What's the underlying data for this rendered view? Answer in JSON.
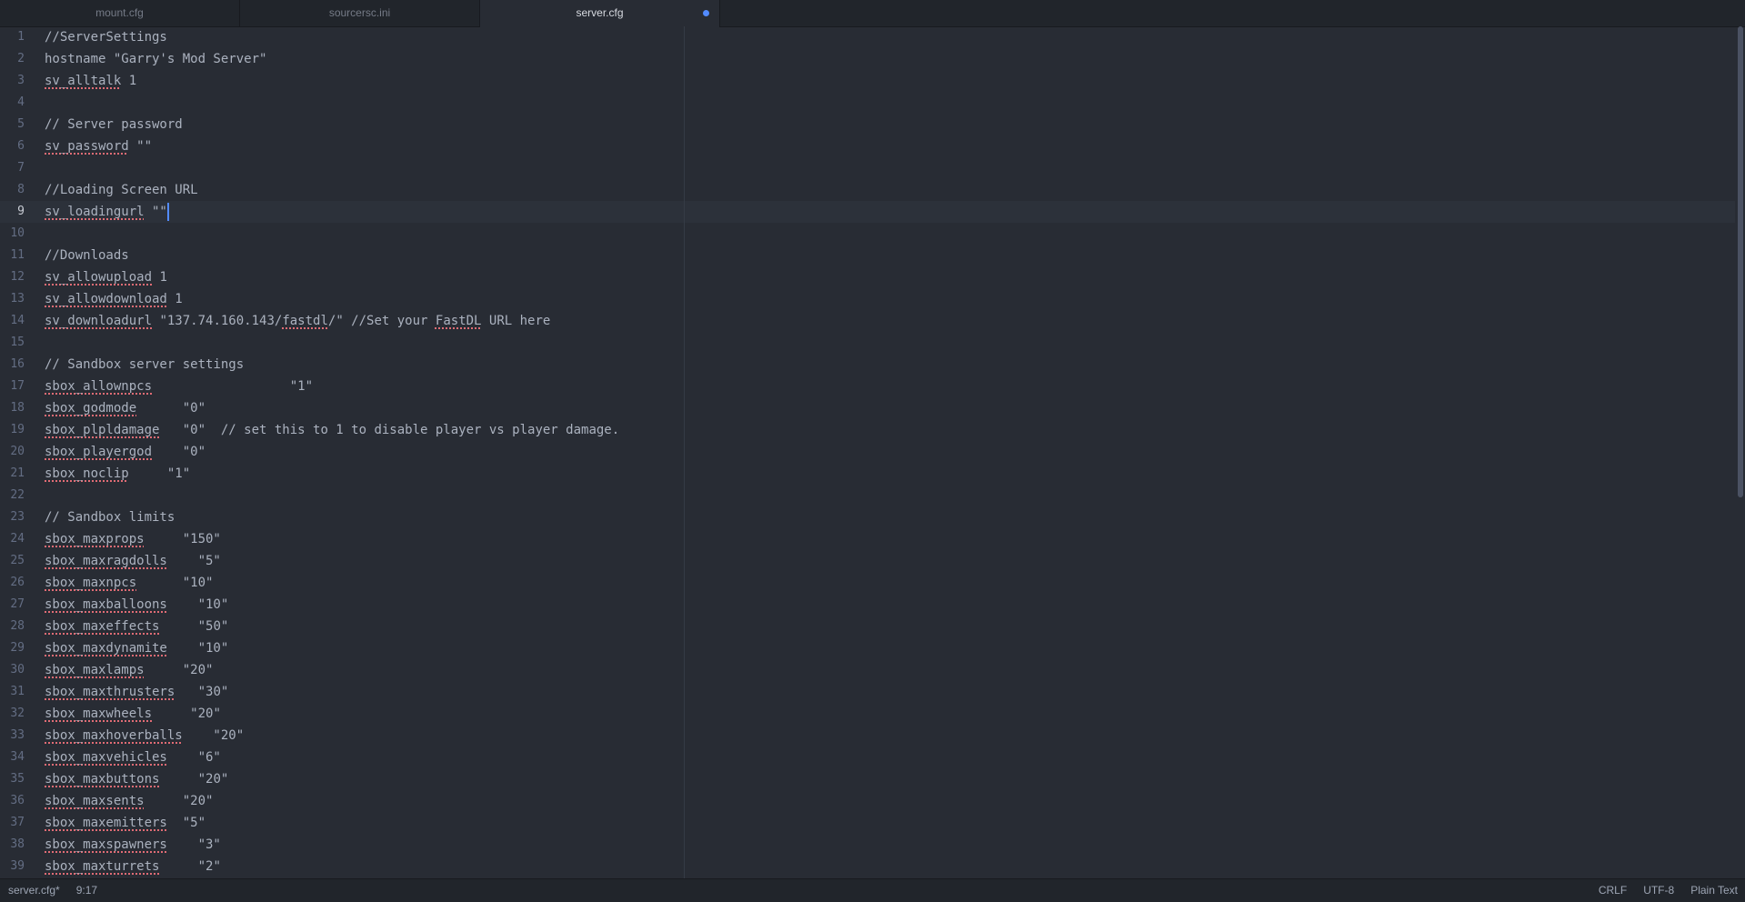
{
  "tabs": [
    {
      "label": "mount.cfg",
      "active": false,
      "modified": false
    },
    {
      "label": "sourcersc.ini",
      "active": false,
      "modified": false
    },
    {
      "label": "server.cfg",
      "active": true,
      "modified": true
    }
  ],
  "editor": {
    "current_line": 9,
    "lines": [
      [
        {
          "t": "//ServerSettings"
        }
      ],
      [
        {
          "t": "hostname \"Garry's Mod Server\""
        }
      ],
      [
        {
          "t": "sv_alltalk",
          "s": true
        },
        {
          "t": " 1"
        }
      ],
      [
        {
          "t": ""
        }
      ],
      [
        {
          "t": "// Server password"
        }
      ],
      [
        {
          "t": "sv_password",
          "s": true
        },
        {
          "t": " \"\""
        }
      ],
      [
        {
          "t": ""
        }
      ],
      [
        {
          "t": "//Loading Screen URL"
        }
      ],
      [
        {
          "t": "sv_loadingurl",
          "s": true
        },
        {
          "t": " \"\""
        }
      ],
      [
        {
          "t": ""
        }
      ],
      [
        {
          "t": "//Downloads"
        }
      ],
      [
        {
          "t": "sv_allowupload",
          "s": true
        },
        {
          "t": " 1"
        }
      ],
      [
        {
          "t": "sv_allowdownload",
          "s": true
        },
        {
          "t": " 1"
        }
      ],
      [
        {
          "t": "sv_downloadurl",
          "s": true
        },
        {
          "t": " \"137.74.160.143/"
        },
        {
          "t": "fastdl",
          "s": true
        },
        {
          "t": "/\" //Set your "
        },
        {
          "t": "FastDL",
          "s": true
        },
        {
          "t": " URL here"
        }
      ],
      [
        {
          "t": ""
        }
      ],
      [
        {
          "t": "// Sandbox server settings"
        }
      ],
      [
        {
          "t": "sbox_allownpcs",
          "s": true
        },
        {
          "t": "                  \"1\""
        }
      ],
      [
        {
          "t": "sbox_godmode",
          "s": true
        },
        {
          "t": "      \"0\""
        }
      ],
      [
        {
          "t": "sbox_plpldamage",
          "s": true
        },
        {
          "t": "   \"0\"  // set this to 1 to disable player vs player damage."
        }
      ],
      [
        {
          "t": "sbox_playergod",
          "s": true
        },
        {
          "t": "    \"0\""
        }
      ],
      [
        {
          "t": "sbox_noclip",
          "s": true
        },
        {
          "t": "     \"1\""
        }
      ],
      [
        {
          "t": ""
        }
      ],
      [
        {
          "t": "// Sandbox limits"
        }
      ],
      [
        {
          "t": "sbox_maxprops",
          "s": true
        },
        {
          "t": "     \"150\""
        }
      ],
      [
        {
          "t": "sbox_maxragdolls",
          "s": true
        },
        {
          "t": "    \"5\""
        }
      ],
      [
        {
          "t": "sbox_maxnpcs",
          "s": true
        },
        {
          "t": "      \"10\""
        }
      ],
      [
        {
          "t": "sbox_maxballoons",
          "s": true
        },
        {
          "t": "    \"10\""
        }
      ],
      [
        {
          "t": "sbox_maxeffects",
          "s": true
        },
        {
          "t": "     \"50\""
        }
      ],
      [
        {
          "t": "sbox_maxdynamite",
          "s": true
        },
        {
          "t": "    \"10\""
        }
      ],
      [
        {
          "t": "sbox_maxlamps",
          "s": true
        },
        {
          "t": "     \"20\""
        }
      ],
      [
        {
          "t": "sbox_maxthrusters",
          "s": true
        },
        {
          "t": "   \"30\""
        }
      ],
      [
        {
          "t": "sbox_maxwheels",
          "s": true
        },
        {
          "t": "     \"20\""
        }
      ],
      [
        {
          "t": "sbox_maxhoverballs",
          "s": true
        },
        {
          "t": "    \"20\""
        }
      ],
      [
        {
          "t": "sbox_maxvehicles",
          "s": true
        },
        {
          "t": "    \"6\""
        }
      ],
      [
        {
          "t": "sbox_maxbuttons",
          "s": true
        },
        {
          "t": "     \"20\""
        }
      ],
      [
        {
          "t": "sbox_maxsents",
          "s": true
        },
        {
          "t": "     \"20\""
        }
      ],
      [
        {
          "t": "sbox_maxemitters",
          "s": true
        },
        {
          "t": "  \"5\""
        }
      ],
      [
        {
          "t": "sbox_maxspawners",
          "s": true
        },
        {
          "t": "    \"3\""
        }
      ],
      [
        {
          "t": "sbox_maxturrets",
          "s": true
        },
        {
          "t": "     \"2\""
        }
      ]
    ]
  },
  "status_bar": {
    "file": "server.cfg*",
    "cursor_position": "9:17",
    "line_ending": "CRLF",
    "encoding": "UTF-8",
    "grammar": "Plain Text"
  },
  "colors": {
    "background": "#282c34",
    "chrome": "#21252b",
    "text": "#abb2bf",
    "gutter_text": "#636d83",
    "spellcheck_underline": "#e06c75",
    "cursor": "#528bff"
  }
}
